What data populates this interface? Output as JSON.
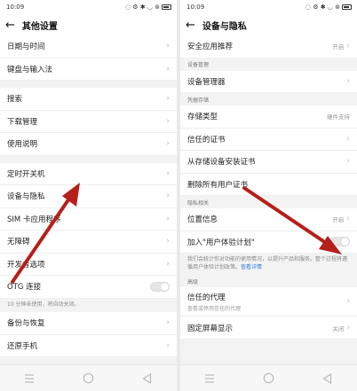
{
  "left": {
    "status": {
      "time": "10:09",
      "icons": "◌ ⚙ ✱ ◡ ⊚"
    },
    "title": "其他设置",
    "items_top": [
      {
        "label": "日期与时间"
      },
      {
        "label": "键盘与输入法"
      }
    ],
    "items_mid1": [
      {
        "label": "搜索"
      },
      {
        "label": "下载管理"
      },
      {
        "label": "使用说明"
      }
    ],
    "items_mid2": [
      {
        "label": "定时开关机"
      },
      {
        "label": "设备与隐私"
      },
      {
        "label": "SIM 卡应用程序"
      },
      {
        "label": "无障碍"
      },
      {
        "label": "开发者选项"
      }
    ],
    "otg": {
      "label": "OTG 连接",
      "note": "10 分钟未使用，将自动关闭。"
    },
    "items_bottom": [
      {
        "label": "备份与恢复"
      },
      {
        "label": "还原手机"
      }
    ]
  },
  "right": {
    "status": {
      "time": "10:09",
      "icons": "◌ ⚙ ✱ ◡ ⊚"
    },
    "title": "设备与隐私",
    "safe_apps": {
      "label": "安全应用推荐",
      "value": "开启"
    },
    "sec_device_mgmt": "设备管理",
    "device_admin": {
      "label": "设备管理器"
    },
    "sec_credential_storage": "凭据存储",
    "storage_type": {
      "label": "存储类型",
      "value": "硬件支持"
    },
    "trusted_certs": {
      "label": "信任的证书"
    },
    "install_from_storage": {
      "label": "从存储设备安装证书"
    },
    "remove_all": {
      "label": "删除所有用户证书"
    },
    "sec_privacy": "隐私相关",
    "location": {
      "label": "位置信息",
      "value": "开启"
    },
    "ux_plan": {
      "label": "加入\"用户体验计划\""
    },
    "ux_note": "我们会统计你对功能的使用情况，以提升产品和服务。整个过程将遵循用户体验计划政策。",
    "ux_link": "查看详情",
    "sec_advanced": "高级",
    "trust_agents": {
      "label": "信任的代理",
      "sub": "查看或停用信任的代理"
    },
    "screen_pinning": {
      "label": "固定屏幕显示",
      "value": "关闭"
    }
  },
  "colors": {
    "arrow": "#b51f1a",
    "link": "#2a7fd4"
  }
}
